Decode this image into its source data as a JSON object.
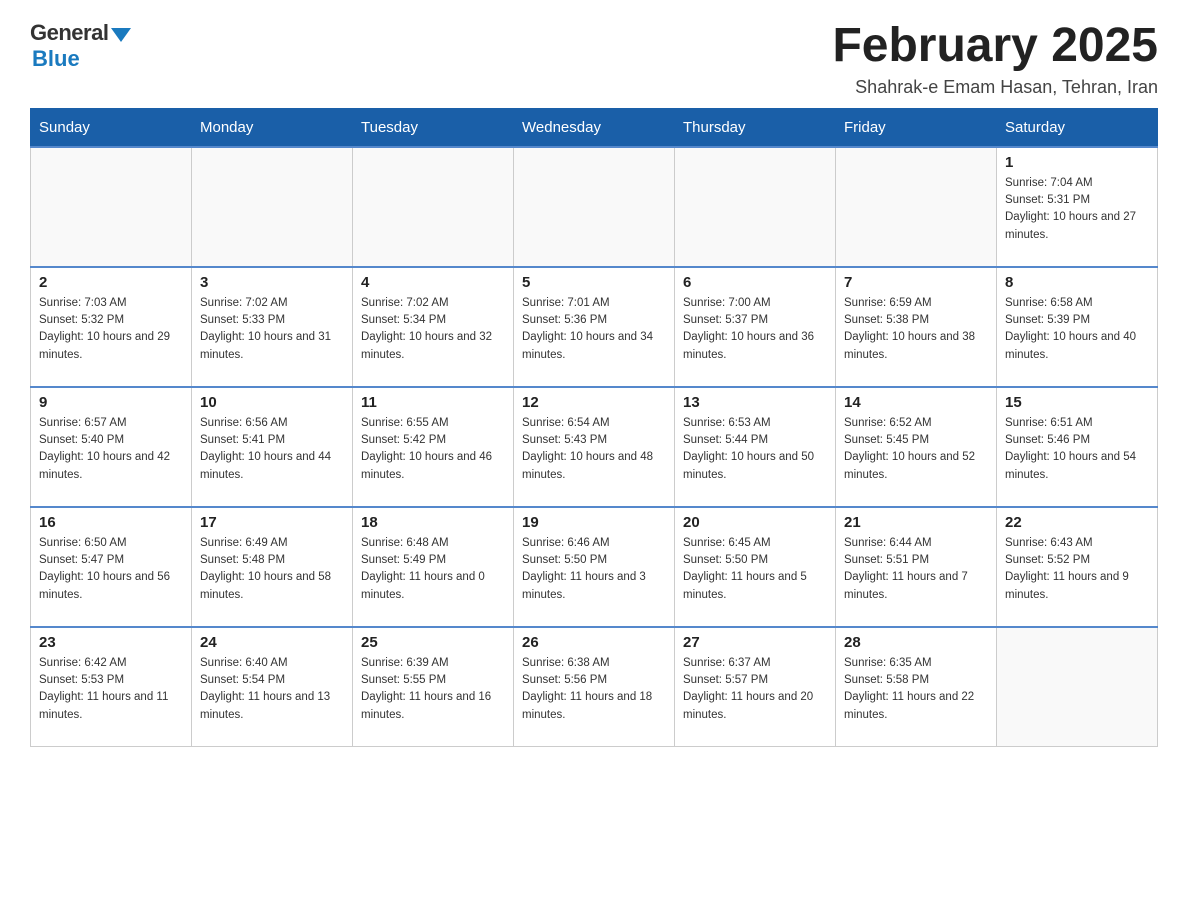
{
  "logo": {
    "general": "General",
    "blue": "Blue",
    "subtitle": ""
  },
  "header": {
    "title": "February 2025",
    "location": "Shahrak-e Emam Hasan, Tehran, Iran"
  },
  "days_of_week": [
    "Sunday",
    "Monday",
    "Tuesday",
    "Wednesday",
    "Thursday",
    "Friday",
    "Saturday"
  ],
  "weeks": [
    [
      {
        "day": "",
        "info": ""
      },
      {
        "day": "",
        "info": ""
      },
      {
        "day": "",
        "info": ""
      },
      {
        "day": "",
        "info": ""
      },
      {
        "day": "",
        "info": ""
      },
      {
        "day": "",
        "info": ""
      },
      {
        "day": "1",
        "info": "Sunrise: 7:04 AM\nSunset: 5:31 PM\nDaylight: 10 hours and 27 minutes."
      }
    ],
    [
      {
        "day": "2",
        "info": "Sunrise: 7:03 AM\nSunset: 5:32 PM\nDaylight: 10 hours and 29 minutes."
      },
      {
        "day": "3",
        "info": "Sunrise: 7:02 AM\nSunset: 5:33 PM\nDaylight: 10 hours and 31 minutes."
      },
      {
        "day": "4",
        "info": "Sunrise: 7:02 AM\nSunset: 5:34 PM\nDaylight: 10 hours and 32 minutes."
      },
      {
        "day": "5",
        "info": "Sunrise: 7:01 AM\nSunset: 5:36 PM\nDaylight: 10 hours and 34 minutes."
      },
      {
        "day": "6",
        "info": "Sunrise: 7:00 AM\nSunset: 5:37 PM\nDaylight: 10 hours and 36 minutes."
      },
      {
        "day": "7",
        "info": "Sunrise: 6:59 AM\nSunset: 5:38 PM\nDaylight: 10 hours and 38 minutes."
      },
      {
        "day": "8",
        "info": "Sunrise: 6:58 AM\nSunset: 5:39 PM\nDaylight: 10 hours and 40 minutes."
      }
    ],
    [
      {
        "day": "9",
        "info": "Sunrise: 6:57 AM\nSunset: 5:40 PM\nDaylight: 10 hours and 42 minutes."
      },
      {
        "day": "10",
        "info": "Sunrise: 6:56 AM\nSunset: 5:41 PM\nDaylight: 10 hours and 44 minutes."
      },
      {
        "day": "11",
        "info": "Sunrise: 6:55 AM\nSunset: 5:42 PM\nDaylight: 10 hours and 46 minutes."
      },
      {
        "day": "12",
        "info": "Sunrise: 6:54 AM\nSunset: 5:43 PM\nDaylight: 10 hours and 48 minutes."
      },
      {
        "day": "13",
        "info": "Sunrise: 6:53 AM\nSunset: 5:44 PM\nDaylight: 10 hours and 50 minutes."
      },
      {
        "day": "14",
        "info": "Sunrise: 6:52 AM\nSunset: 5:45 PM\nDaylight: 10 hours and 52 minutes."
      },
      {
        "day": "15",
        "info": "Sunrise: 6:51 AM\nSunset: 5:46 PM\nDaylight: 10 hours and 54 minutes."
      }
    ],
    [
      {
        "day": "16",
        "info": "Sunrise: 6:50 AM\nSunset: 5:47 PM\nDaylight: 10 hours and 56 minutes."
      },
      {
        "day": "17",
        "info": "Sunrise: 6:49 AM\nSunset: 5:48 PM\nDaylight: 10 hours and 58 minutes."
      },
      {
        "day": "18",
        "info": "Sunrise: 6:48 AM\nSunset: 5:49 PM\nDaylight: 11 hours and 0 minutes."
      },
      {
        "day": "19",
        "info": "Sunrise: 6:46 AM\nSunset: 5:50 PM\nDaylight: 11 hours and 3 minutes."
      },
      {
        "day": "20",
        "info": "Sunrise: 6:45 AM\nSunset: 5:50 PM\nDaylight: 11 hours and 5 minutes."
      },
      {
        "day": "21",
        "info": "Sunrise: 6:44 AM\nSunset: 5:51 PM\nDaylight: 11 hours and 7 minutes."
      },
      {
        "day": "22",
        "info": "Sunrise: 6:43 AM\nSunset: 5:52 PM\nDaylight: 11 hours and 9 minutes."
      }
    ],
    [
      {
        "day": "23",
        "info": "Sunrise: 6:42 AM\nSunset: 5:53 PM\nDaylight: 11 hours and 11 minutes."
      },
      {
        "day": "24",
        "info": "Sunrise: 6:40 AM\nSunset: 5:54 PM\nDaylight: 11 hours and 13 minutes."
      },
      {
        "day": "25",
        "info": "Sunrise: 6:39 AM\nSunset: 5:55 PM\nDaylight: 11 hours and 16 minutes."
      },
      {
        "day": "26",
        "info": "Sunrise: 6:38 AM\nSunset: 5:56 PM\nDaylight: 11 hours and 18 minutes."
      },
      {
        "day": "27",
        "info": "Sunrise: 6:37 AM\nSunset: 5:57 PM\nDaylight: 11 hours and 20 minutes."
      },
      {
        "day": "28",
        "info": "Sunrise: 6:35 AM\nSunset: 5:58 PM\nDaylight: 11 hours and 22 minutes."
      },
      {
        "day": "",
        "info": ""
      }
    ]
  ]
}
